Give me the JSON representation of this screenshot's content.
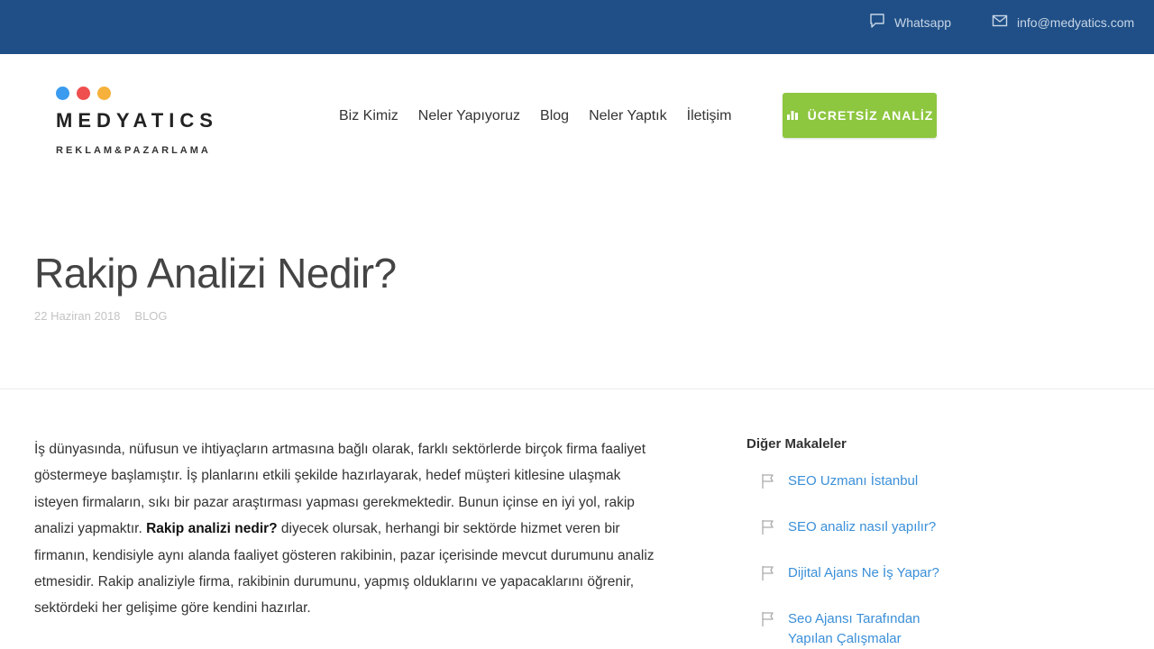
{
  "topbar": {
    "whatsapp_label": "Whatsapp",
    "email_label": "info@medyatics.com"
  },
  "logo": {
    "brand": "MEDYATICS",
    "tagline": "REKLAM&PAZARLAMA",
    "dot_colors": [
      "#3b9bef",
      "#ef4f4f",
      "#f5b13b"
    ]
  },
  "nav": {
    "items": [
      "Biz Kimiz",
      "Neler Yapıyoruz",
      "Blog",
      "Neler Yaptık",
      "İletişim"
    ]
  },
  "cta": {
    "label": "ÜCRETSİZ ANALİZ"
  },
  "hero": {
    "title": "Rakip Analizi Nedir?",
    "date": "22 Haziran 2018",
    "category": "BLOG"
  },
  "article": {
    "p1_a": "İş dünyasında, nüfusun ve ihtiyaçların artmasına bağlı olarak, farklı sektörlerde birçok firma faaliyet göstermeye başlamıştır. İş planlarını etkili şekilde hazırlayarak, hedef müşteri kitlesine ulaşmak isteyen firmaların, sıkı bir pazar araştırması yapması gerekmektedir. Bunun içinse en iyi yol, rakip analizi yapmaktır.",
    "p1_bold": "Rakip analizi nedir?",
    "p1_b": " diyecek olursak, herhangi bir sektörde hizmet veren bir firmanın, kendisiyle aynı alanda faaliyet gösteren rakibinin, pazar içerisinde mevcut durumunu analiz etmesidir. Rakip analiziyle firma, rakibinin durumunu, yapmış olduklarını ve yapacaklarını öğrenir, sektördeki her gelişime göre kendini hazırlar."
  },
  "sidebar": {
    "title": "Diğer Makaleler",
    "items": [
      "SEO Uzmanı İstanbul",
      "SEO analiz nasıl yapılır?",
      "Dijital Ajans Ne İş Yapar?",
      "Seo Ajansı Tarafından Yapılan Çalışmalar"
    ]
  },
  "colors": {
    "topbar": "#1f4f86",
    "cta": "#8dc63f",
    "link": "#3a8fd8"
  }
}
